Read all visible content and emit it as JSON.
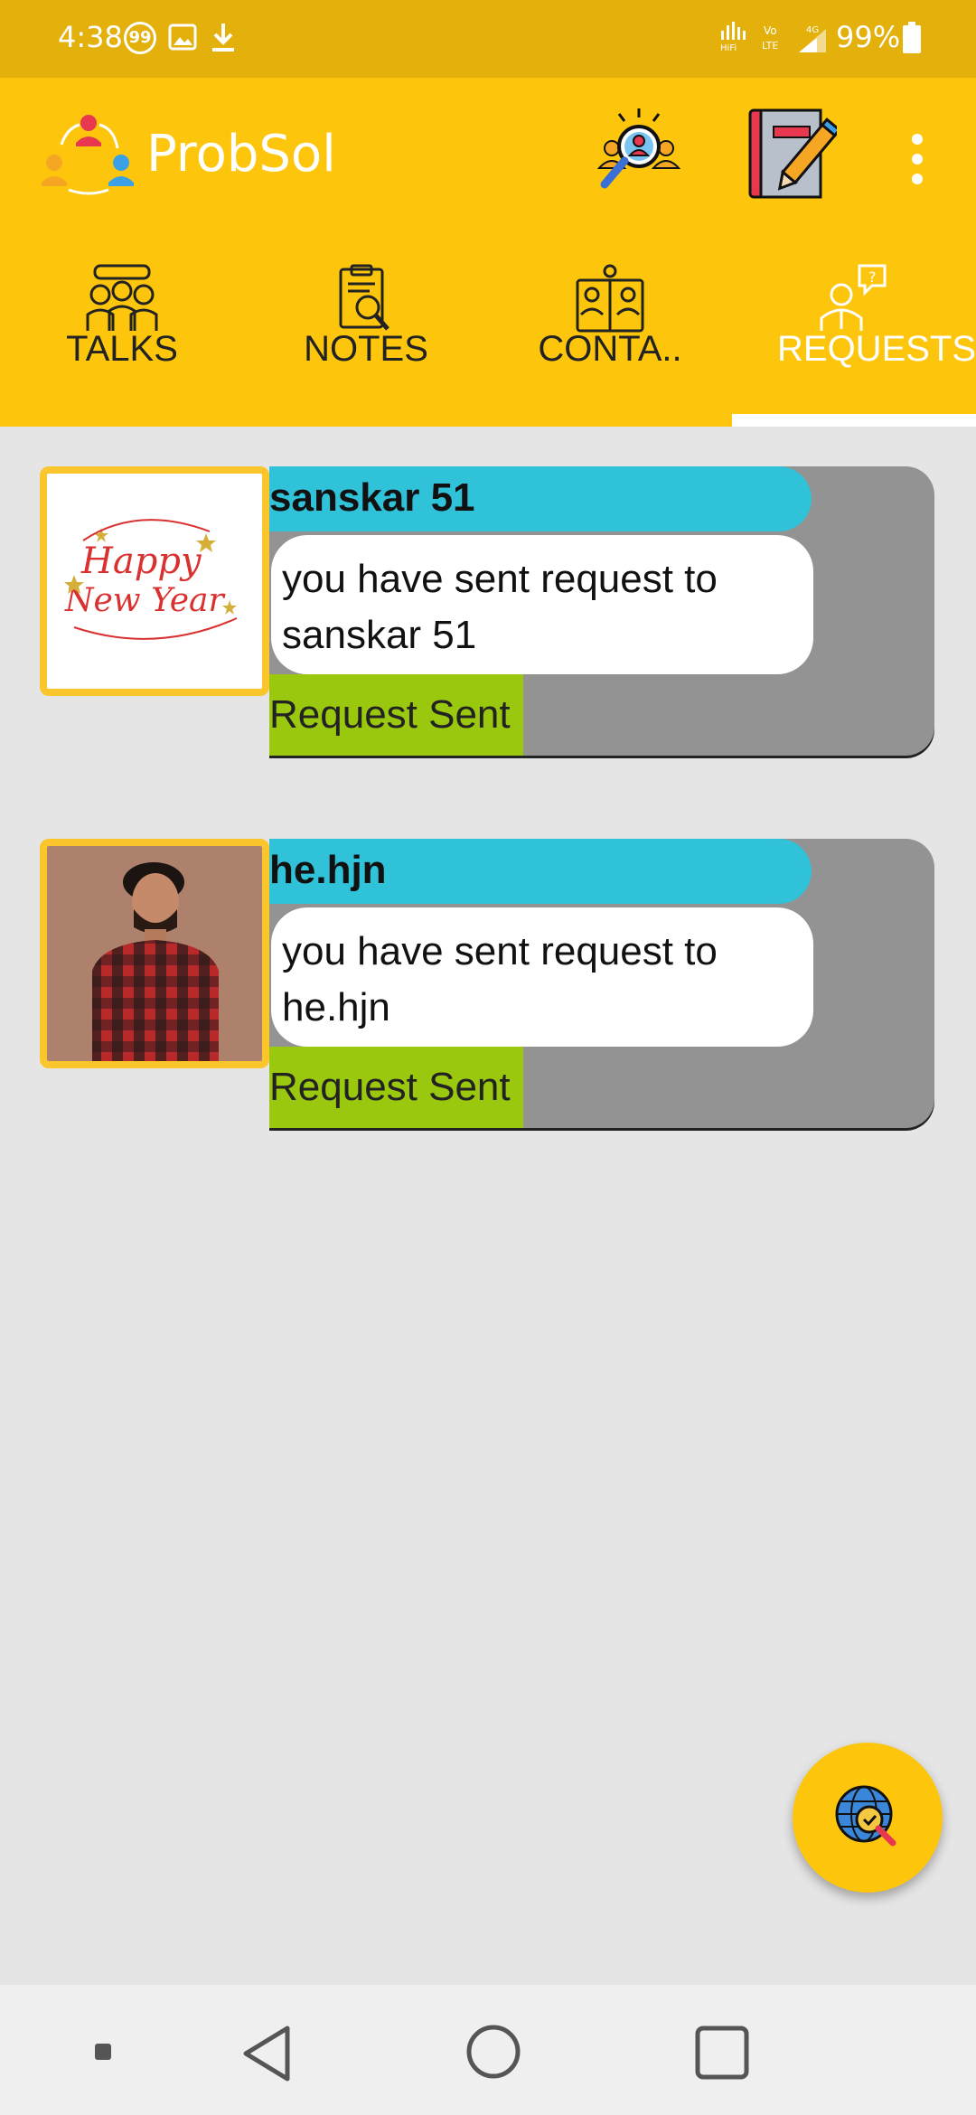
{
  "status_bar": {
    "time": "4:38",
    "badge_count": "99",
    "battery": "99%",
    "network_label": "4G",
    "icons": [
      "image-icon",
      "download-icon",
      "hifi-signal-icon",
      "volte-icon",
      "signal-icon",
      "battery-icon"
    ]
  },
  "app": {
    "title": "ProbSol",
    "accent_color": "#fdc60d",
    "tabs": [
      {
        "label": "TALKS",
        "icon": "talks-icon"
      },
      {
        "label": "NOTES",
        "icon": "notes-icon"
      },
      {
        "label": "CONTA..",
        "icon": "contacts-icon"
      },
      {
        "label": "REQUESTS",
        "icon": "requests-icon",
        "active": true
      }
    ]
  },
  "requests": [
    {
      "name": "sanskar 51",
      "message": "you have sent request to sanskar 51",
      "status": "Request Sent",
      "avatar": "happy-new-year-image",
      "avatar_text_1": "Happy",
      "avatar_text_2": "New Year"
    },
    {
      "name": "he.hjn",
      "message": "you have sent request to he.hjn",
      "status": "Request Sent",
      "avatar": "man-in-plaid-shirt-photo"
    }
  ],
  "fab": {
    "icon": "globe-search-icon"
  },
  "nav": {
    "icons": [
      "menu-dot-icon",
      "back-icon",
      "home-icon",
      "recents-icon"
    ]
  }
}
